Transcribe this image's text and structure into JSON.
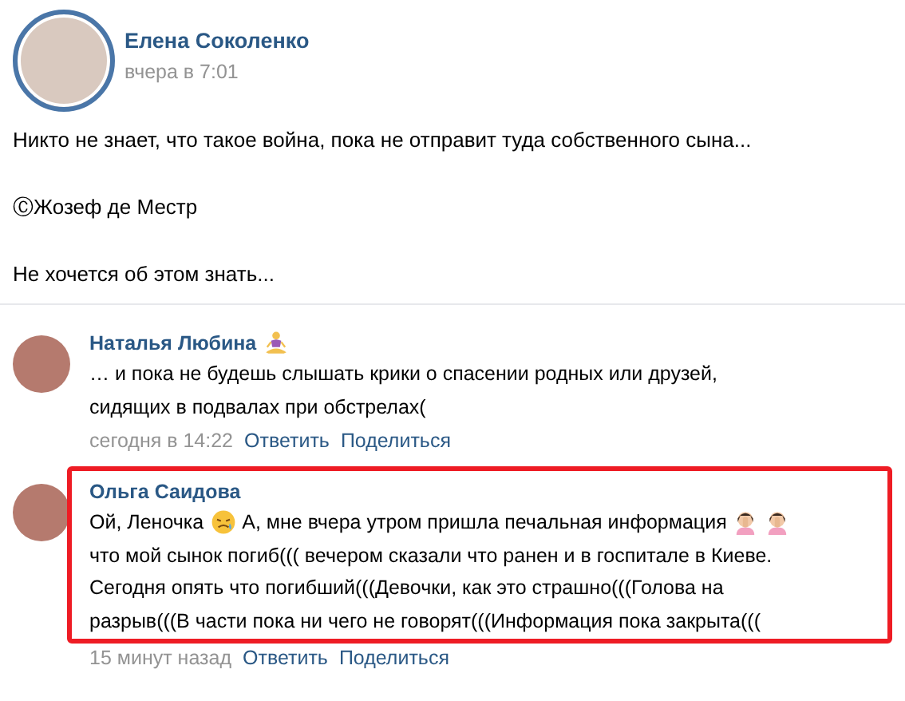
{
  "post": {
    "author": "Елена Соколенко",
    "time": "вчера в 7:01",
    "paragraphs": [
      "Никто не знает, что такое война, пока не отправит туда собственного сына...",
      "ⒸЖозеф де Местр",
      "Не хочется об этом знать..."
    ]
  },
  "comments": [
    {
      "author": "Наталья Любина",
      "author_emoji": true,
      "highlighted": false,
      "lines": [
        [
          {
            "kind": "text",
            "text": "… и пока не будешь слышать крики о спасении родных или друзей,"
          }
        ],
        [
          {
            "kind": "text",
            "text": "сидящих в подвалах при обстрелах("
          }
        ]
      ],
      "time": "сегодня в 14:22",
      "actions": [
        "Ответить",
        "Поделиться"
      ]
    },
    {
      "author": "Ольга Саидова",
      "author_emoji": false,
      "highlighted": true,
      "lines": [
        [
          {
            "kind": "text",
            "text": "Ой, Леночка"
          },
          {
            "kind": "sad-face"
          },
          {
            "kind": "text",
            "text": "А, мне вчера утром пришла печальная информация"
          },
          {
            "kind": "facepalm"
          },
          {
            "kind": "facepalm"
          }
        ],
        [
          {
            "kind": "text",
            "text": "что мой сынок погиб((( вечером сказали что ранен и в госпитале в Киеве."
          }
        ],
        [
          {
            "kind": "text",
            "text": "Сегодня опять что погибший(((Девочки, как это страшно(((Голова на"
          }
        ],
        [
          {
            "kind": "text",
            "text": "разрыв(((В части пока ни чего не говорят(((Информация пока закрыта((("
          }
        ]
      ],
      "time": "15 минут назад",
      "actions": [
        "Ответить",
        "Поделиться"
      ]
    }
  ]
}
